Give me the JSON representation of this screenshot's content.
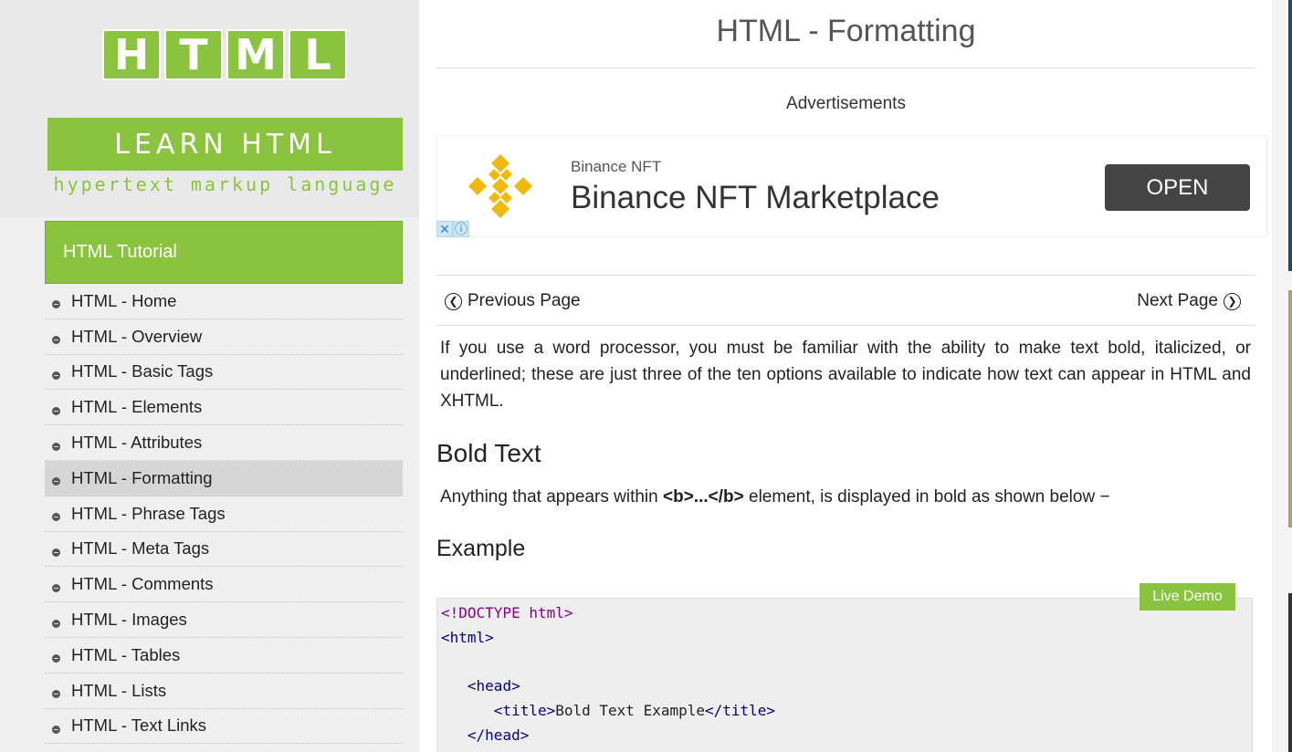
{
  "logo": {
    "letters": [
      "H",
      "T",
      "M",
      "L"
    ],
    "learn": "LEARN HTML",
    "subtitle": "hypertext markup language"
  },
  "sidebar": {
    "header": "HTML Tutorial",
    "items": [
      {
        "label": "HTML - Home",
        "active": false
      },
      {
        "label": "HTML - Overview",
        "active": false
      },
      {
        "label": "HTML - Basic Tags",
        "active": false
      },
      {
        "label": "HTML - Elements",
        "active": false
      },
      {
        "label": "HTML - Attributes",
        "active": false
      },
      {
        "label": "HTML - Formatting",
        "active": true
      },
      {
        "label": "HTML - Phrase Tags",
        "active": false
      },
      {
        "label": "HTML - Meta Tags",
        "active": false
      },
      {
        "label": "HTML - Comments",
        "active": false
      },
      {
        "label": "HTML - Images",
        "active": false
      },
      {
        "label": "HTML - Tables",
        "active": false
      },
      {
        "label": "HTML - Lists",
        "active": false
      },
      {
        "label": "HTML - Text Links",
        "active": false
      }
    ]
  },
  "main": {
    "title": "HTML - Formatting",
    "ads_label": "Advertisements",
    "ad": {
      "brand_small": "Binance NFT",
      "brand_big": "Binance NFT Marketplace",
      "cta": "OPEN",
      "close_glyph": "✕",
      "info_glyph": "ⓘ",
      "logo_color": "#f0b90b"
    },
    "pager": {
      "prev": "Previous Page",
      "next": "Next Page"
    },
    "intro": "If you use a word processor, you must be familiar with the ability to make text bold, italicized, or underlined; these are just three of the ten options available to indicate how text can appear in HTML and XHTML.",
    "bold_heading": "Bold Text",
    "bold_desc_before": "Anything that appears within ",
    "bold_desc_code": "<b>...</b>",
    "bold_desc_after": " element, is displayed in bold as shown below −",
    "example_heading": "Example",
    "live_demo": "Live Demo",
    "code_lines": [
      {
        "indent": "",
        "parts": [
          {
            "t": "<!DOCTYPE html>",
            "c": "decl"
          }
        ]
      },
      {
        "indent": "",
        "parts": [
          {
            "t": "<html>",
            "c": "tag"
          }
        ]
      },
      {
        "indent": "",
        "parts": []
      },
      {
        "indent": "   ",
        "parts": [
          {
            "t": "<head>",
            "c": "tag"
          }
        ]
      },
      {
        "indent": "      ",
        "parts": [
          {
            "t": "<title>",
            "c": "tag"
          },
          {
            "t": "Bold Text Example",
            "c": "txt"
          },
          {
            "t": "</title>",
            "c": "tag"
          }
        ]
      },
      {
        "indent": "   ",
        "parts": [
          {
            "t": "</head>",
            "c": "tag"
          }
        ]
      }
    ]
  },
  "colors": {
    "accent": "#8ac43f",
    "ad_button": "#444444",
    "active_item": "#d6d6d6"
  }
}
